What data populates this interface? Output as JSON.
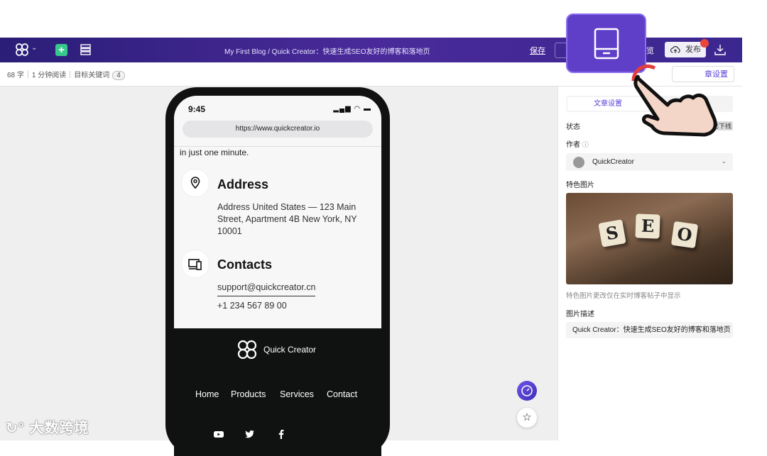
{
  "topbar": {
    "breadcrumb": "My First Blog / Quick Creator：快速生成SEO友好的博客和落地页",
    "save_label": "保存",
    "preview_label": "览",
    "publish_label": "发布"
  },
  "stats": {
    "words": "68 字",
    "read_time": "1 分钟阅读",
    "keywords_label": "目标关键词",
    "keywords_count": "4"
  },
  "phone": {
    "time": "9:45",
    "url": "https://www.quickcreator.io",
    "intro_tail": "in just one minute.",
    "address_title": "Address",
    "address_text": "Address United States — 123 Main Street, Apartment 4B New York, NY 10001",
    "contacts_title": "Contacts",
    "email": "support@quickcreator.cn",
    "phone_number": "+1 234 567 89 00",
    "footer_brand": "Quick Creator",
    "footer_nav": [
      "Home",
      "Products",
      "Services",
      "Contact"
    ]
  },
  "panel": {
    "article_settings_btn": "章设置",
    "tab_active": "文章设置",
    "status_label": "状态",
    "status_value": "已下线",
    "author_label": "作者",
    "author_name": "QuickCreator",
    "featured_label": "特色图片",
    "featured_hint": "特色图片更改仅在实时博客帖子中显示",
    "image_desc_label": "图片描述",
    "image_desc_value": "Quick Creator：快速生成SEO友好的博客和落地页",
    "image_letters": [
      "S",
      "E",
      "O"
    ]
  },
  "watermark": "大数跨境",
  "colors": {
    "topbar": "#3b2790",
    "accent": "#5a42d8",
    "publish_dot": "#e9473a"
  }
}
